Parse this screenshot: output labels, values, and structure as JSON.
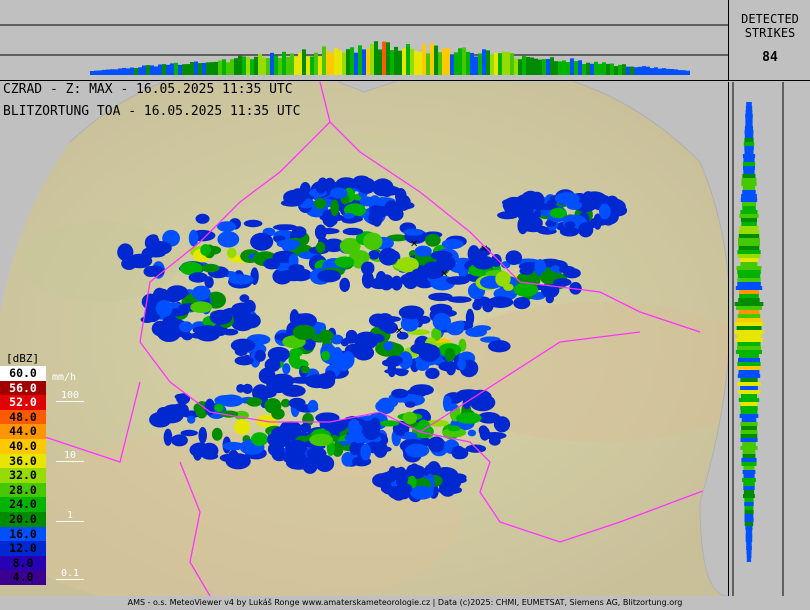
{
  "strikes": {
    "heading_line1": "DETECTED",
    "heading_line2": "STRIKES",
    "count": "84"
  },
  "titles": {
    "radar": "CZRAD - Z: MAX - 16.05.2025 11:35 UTC",
    "lightning": "BLITZORTUNG TOA - 16.05.2025 11:35 UTC"
  },
  "legend": {
    "unit": "[dBZ]",
    "rain_unit": "mm/h",
    "levels": [
      {
        "label": "60.0",
        "color": "#ffffff",
        "text": "#000000"
      },
      {
        "label": "56.0",
        "color": "#a00000",
        "text": "#ffffff"
      },
      {
        "label": "52.0",
        "color": "#e00000",
        "text": "#ffffff"
      },
      {
        "label": "48.0",
        "color": "#ff5a00",
        "text": "#000000"
      },
      {
        "label": "44.0",
        "color": "#ff9600",
        "text": "#000000"
      },
      {
        "label": "40.0",
        "color": "#ffc800",
        "text": "#000000"
      },
      {
        "label": "36.0",
        "color": "#e6e600",
        "text": "#000000"
      },
      {
        "label": "32.0",
        "color": "#96dc00",
        "text": "#000000"
      },
      {
        "label": "28.0",
        "color": "#46c800",
        "text": "#000000"
      },
      {
        "label": "24.0",
        "color": "#00b400",
        "text": "#000000"
      },
      {
        "label": "20.0",
        "color": "#008c00",
        "text": "#000000"
      },
      {
        "label": "16.0",
        "color": "#0050ff",
        "text": "#000000"
      },
      {
        "label": "12.0",
        "color": "#0028d0",
        "text": "#000000"
      },
      {
        "label": "8.0",
        "color": "#2800b4",
        "text": "#000000"
      },
      {
        "label": "4.0",
        "color": "#3c0090",
        "text": "#000000"
      }
    ],
    "rain_levels": [
      "100",
      "10",
      "1",
      "0.1"
    ]
  },
  "footer": "AMS - o.s. MeteoViewer v4 by Lukáš Ronge www.amaterskameteorologie.cz | Data (c)2025: CHMI, EUMETSAT, Siemens AG, Blitzortung.org",
  "colors": {
    "background": "#c0c0c0",
    "border_line": "#ff33ff",
    "map_land": "#cfd4a8"
  }
}
